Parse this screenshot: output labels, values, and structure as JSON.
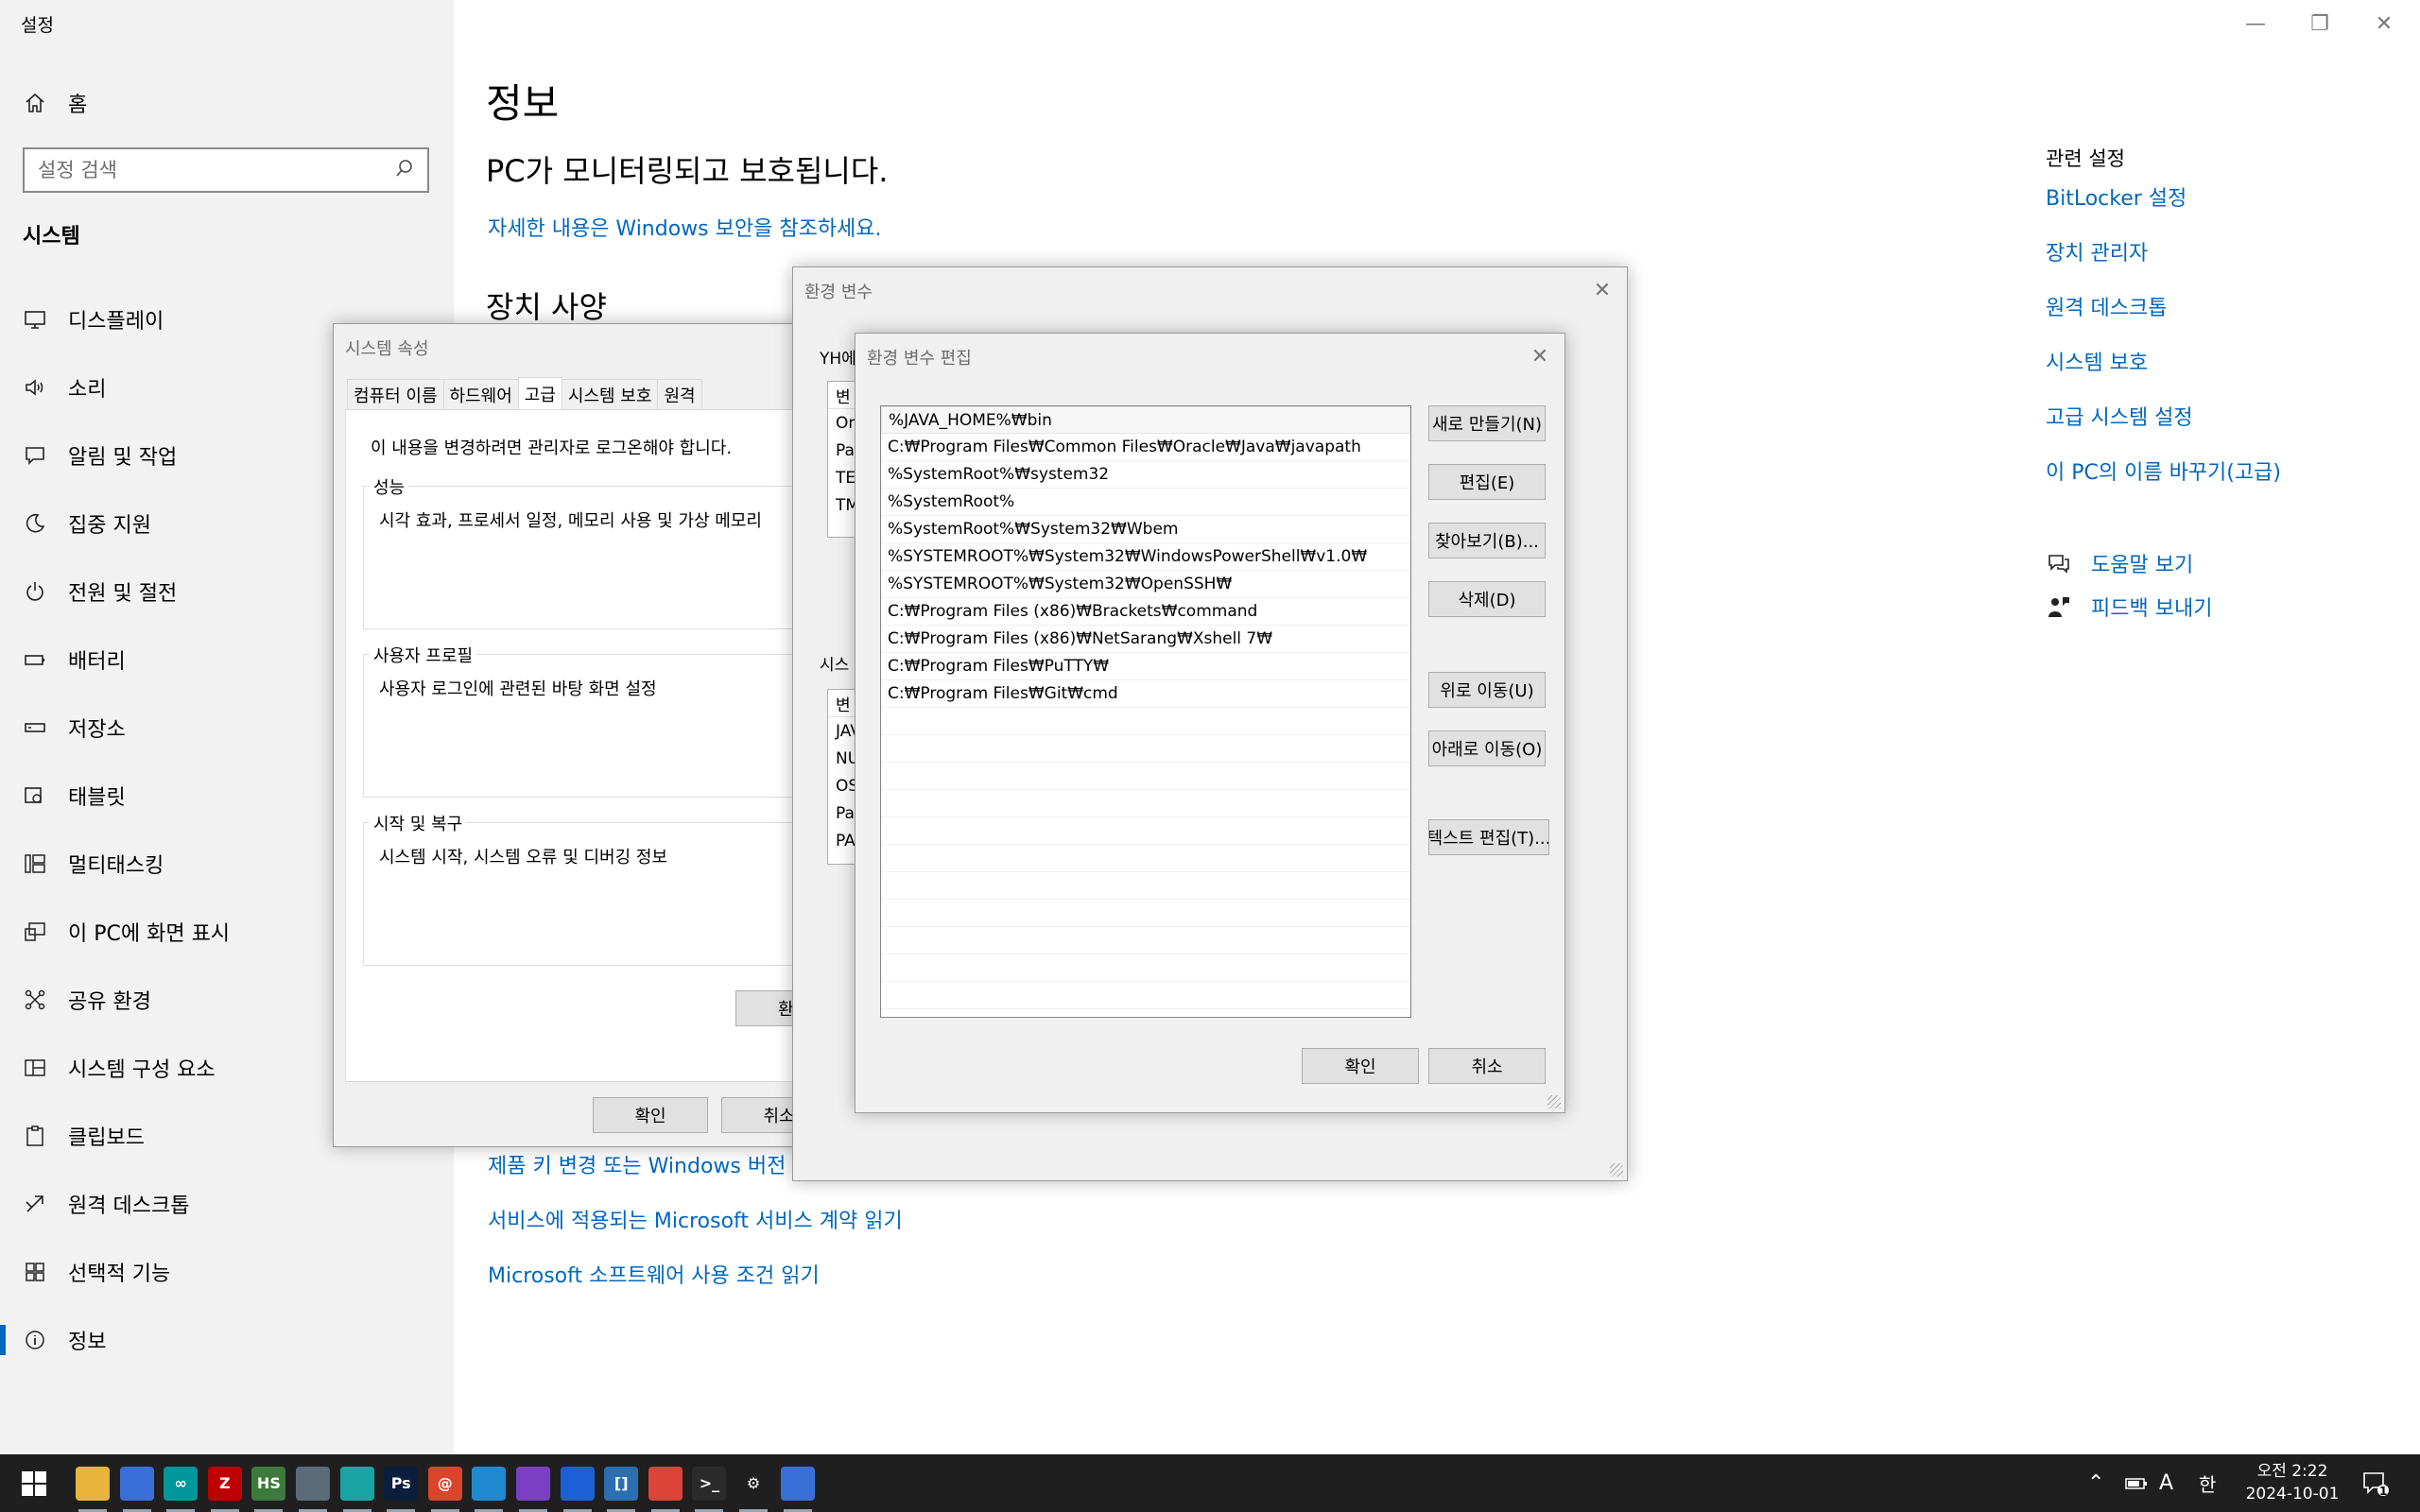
{
  "settings": {
    "app_title": "설정",
    "home_label": "홈",
    "search_placeholder": "설정 검색",
    "section_title": "시스템",
    "nav": [
      {
        "label": "디스플레이",
        "icon": "display-icon"
      },
      {
        "label": "소리",
        "icon": "speaker-icon"
      },
      {
        "label": "알림 및 작업",
        "icon": "notification-icon"
      },
      {
        "label": "집중 지원",
        "icon": "moon-icon"
      },
      {
        "label": "전원 및 절전",
        "icon": "power-icon"
      },
      {
        "label": "배터리",
        "icon": "battery-icon"
      },
      {
        "label": "저장소",
        "icon": "storage-icon"
      },
      {
        "label": "태블릿",
        "icon": "tablet-icon"
      },
      {
        "label": "멀티태스킹",
        "icon": "multitasking-icon"
      },
      {
        "label": "이 PC에 화면 표시",
        "icon": "project-icon"
      },
      {
        "label": "공유 환경",
        "icon": "shared-icon"
      },
      {
        "label": "시스템 구성 요소",
        "icon": "components-icon"
      },
      {
        "label": "클립보드",
        "icon": "clipboard-icon"
      },
      {
        "label": "원격 데스크톱",
        "icon": "remote-icon"
      },
      {
        "label": "선택적 기능",
        "icon": "features-icon"
      },
      {
        "label": "정보",
        "icon": "info-icon"
      }
    ],
    "active_nav": "정보",
    "page_title": "정보",
    "protected_text": "PC가 모니터링되고 보호됩니다.",
    "security_link": "자세한 내용은 Windows 보안을 참조하세요.",
    "device_spec_title": "장치 사양",
    "bottom_links": [
      "제품 키 변경 또는 Windows 버전",
      "서비스에 적용되는 Microsoft 서비스 계약 읽기",
      "Microsoft 소프트웨어 사용 조건 읽기"
    ],
    "related_title": "관련 설정",
    "related_links": [
      "BitLocker 설정",
      "장치 관리자",
      "원격 데스크톱",
      "시스템 보호",
      "고급 시스템 설정",
      "이 PC의 이름 바꾸기(고급)"
    ],
    "help_label": "도움말 보기",
    "feedback_label": "피드백 보내기"
  },
  "system_properties": {
    "title": "시스템 속성",
    "tabs": [
      "컴퓨터 이름",
      "하드웨어",
      "고급",
      "시스템 보호",
      "원격"
    ],
    "selected_tab": "고급",
    "admin_note": "이 내용을 변경하려면 관리자로 로그온해야 합니다.",
    "groups": [
      {
        "label": "성능",
        "text": "시각 효과, 프로세서 일정, 메모리 사용 및 가상 메모리"
      },
      {
        "label": "사용자 프로필",
        "text": "사용자 로그인에 관련된 바탕 화면 설정"
      },
      {
        "label": "시작 및 복구",
        "text": "시스템 시작, 시스템 오류 및 디버깅 정보"
      }
    ],
    "env_button_partial": "환",
    "ok_label": "확인",
    "cancel_partial": "취소"
  },
  "env_vars": {
    "title": "환경 변수",
    "user_section_partial": "YH에",
    "user_header_partial": "변",
    "user_rows_partial": [
      "On",
      "Pat",
      "TE",
      "TM"
    ],
    "system_section_partial": "시스",
    "system_header_partial": "변",
    "system_rows_partial": [
      "JAV",
      "NU",
      "OS",
      "Pat",
      "PA"
    ]
  },
  "edit_env": {
    "title": "환경 변수 편집",
    "paths": [
      "%JAVA_HOME%₩bin",
      "C:₩Program Files₩Common Files₩Oracle₩Java₩javapath",
      "%SystemRoot%₩system32",
      "%SystemRoot%",
      "%SystemRoot%₩System32₩Wbem",
      "%SYSTEMROOT%₩System32₩WindowsPowerShell₩v1.0₩",
      "%SYSTEMROOT%₩System32₩OpenSSH₩",
      "C:₩Program Files (x86)₩Brackets₩command",
      "C:₩Program Files (x86)₩NetSarang₩Xshell 7₩",
      "C:₩Program Files₩PuTTY₩",
      "C:₩Program Files₩Git₩cmd"
    ],
    "buttons": {
      "new": "새로 만들기(N)",
      "edit": "편집(E)",
      "browse": "찾아보기(B)...",
      "delete": "삭제(D)",
      "move_up": "위로 이동(U)",
      "move_down": "아래로 이동(O)",
      "text_edit": "텍스트 편집(T)..."
    },
    "ok_label": "확인",
    "cancel_label": "취소"
  },
  "taskbar": {
    "apps": [
      {
        "name": "file-explorer-icon",
        "glyph": "",
        "color": "#e8b53a"
      },
      {
        "name": "network-tool-icon",
        "glyph": "",
        "color": "#3a6fd8"
      },
      {
        "name": "arduino-icon",
        "glyph": "∞",
        "color": "#00979c"
      },
      {
        "name": "filezilla-icon",
        "glyph": "Z",
        "color": "#bf0000"
      },
      {
        "name": "hs-app-icon",
        "glyph": "HS",
        "color": "#3d7a3d"
      },
      {
        "name": "calculator-icon",
        "glyph": "",
        "color": "#5b6b7a"
      },
      {
        "name": "bird-app-icon",
        "glyph": "",
        "color": "#1aa5a5"
      },
      {
        "name": "photoshop-icon",
        "glyph": "Ps",
        "color": "#0b1e3d"
      },
      {
        "name": "snail-app-icon",
        "glyph": "@",
        "color": "#d9442b"
      },
      {
        "name": "vscode-icon",
        "glyph": "",
        "color": "#1f8ad2"
      },
      {
        "name": "visual-studio-icon",
        "glyph": "",
        "color": "#7b3fc4"
      },
      {
        "name": "location-app-icon",
        "glyph": "",
        "color": "#1c5fd6"
      },
      {
        "name": "bracket-app-icon",
        "glyph": "[]",
        "color": "#2c6fb0"
      },
      {
        "name": "chrome-icon",
        "glyph": "",
        "color": "#db4437"
      },
      {
        "name": "terminal-icon",
        "glyph": ">_",
        "color": "#2b2b2b"
      },
      {
        "name": "settings-icon",
        "glyph": "⚙",
        "color": "#1f1f1f"
      },
      {
        "name": "system-properties-icon",
        "glyph": "",
        "color": "#3a6fd8"
      }
    ],
    "tray_ime_a": "A",
    "tray_ime_han": "한",
    "clock_time": "오전 2:22",
    "clock_date": "2024-10-01",
    "notification_count": "1"
  }
}
